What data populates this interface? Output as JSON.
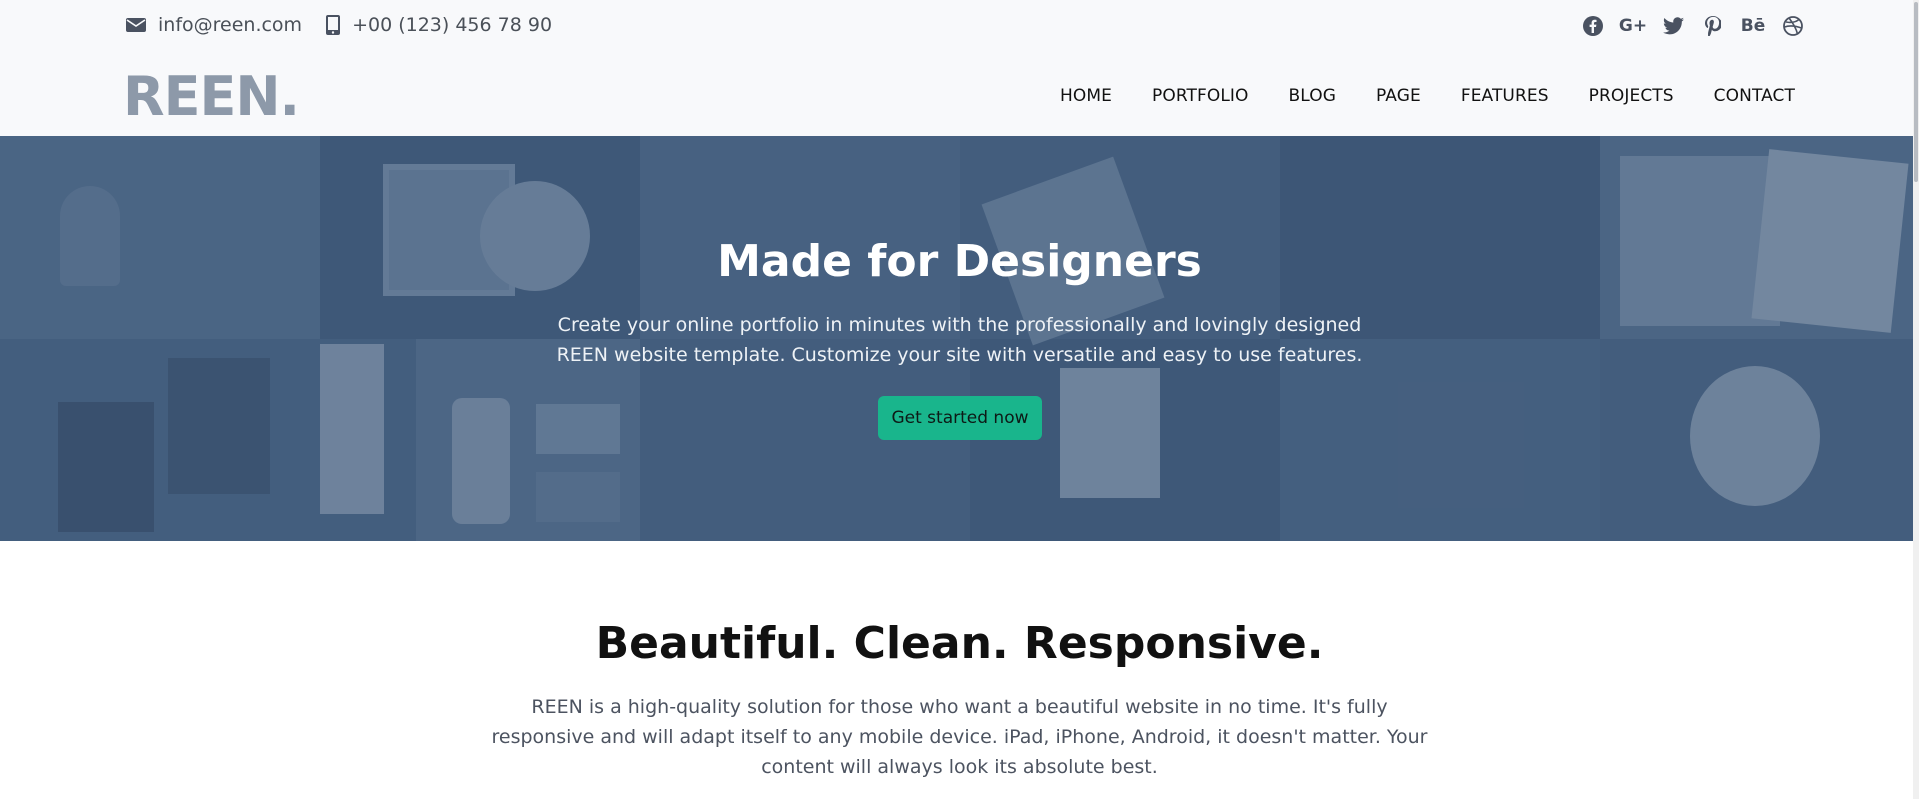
{
  "header": {
    "email": "info@reen.com",
    "phone": "+00 (123) 456 78 90",
    "social_icons": [
      "facebook-icon",
      "google-plus-icon",
      "twitter-icon",
      "pinterest-icon",
      "behance-icon",
      "dribbble-icon"
    ],
    "social_labels": {
      "google_plus": "G+",
      "behance": "Bē"
    },
    "logo": "REEN.",
    "nav": [
      "HOME",
      "PORTFOLIO",
      "BLOG",
      "PAGE",
      "FEATURES",
      "PROJECTS",
      "CONTACT"
    ]
  },
  "hero": {
    "title": "Made for Designers",
    "text": "Create your online portfolio in minutes with the professionally and lovingly designed REEN website template. Customize your site with versatile and easy to use features.",
    "cta": "Get started now"
  },
  "intro": {
    "title": "Beautiful. Clean. Responsive.",
    "text": "REEN is a high-quality solution for those who want a beautiful website in no time. It's fully responsive and will adapt itself to any mobile device. iPad, iPhone, Android, it doesn't matter. Your content will always look its absolute best."
  },
  "colors": {
    "accent": "#19b58c",
    "hero_overlay": "#45607f",
    "logo": "#8d99a9"
  }
}
